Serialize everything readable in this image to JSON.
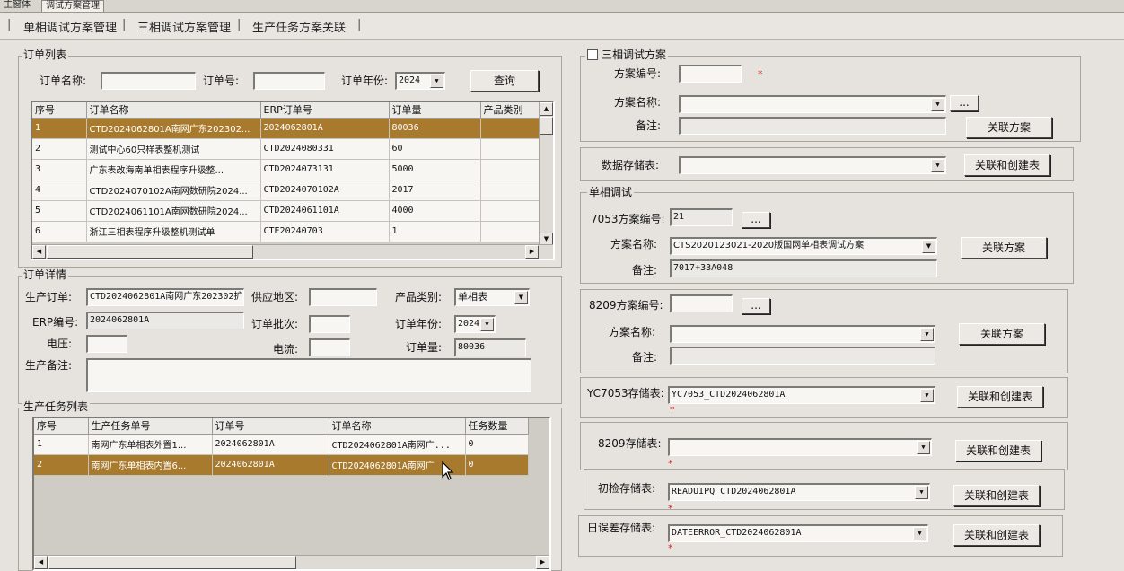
{
  "tabs": [
    "主窗体",
    "调试方案管理"
  ],
  "menu": [
    "单相调试方案管理",
    "三相调试方案管理",
    "生产任务方案关联"
  ],
  "order_list": {
    "title": "订单列表",
    "name_label": "订单名称:",
    "name_value": "",
    "no_label": "订单号:",
    "no_value": "",
    "year_label": "订单年份:",
    "year_value": "2024",
    "query_button": "查询",
    "columns": [
      "序号",
      "订单名称",
      "ERP订单号",
      "订单量",
      "产品类别"
    ],
    "rows": [
      [
        "1",
        "CTD2024062801A南网广东202302...",
        "2024062801A",
        "80036",
        ""
      ],
      [
        "2",
        "测试中心60只样表整机测试",
        "CTD2024080331",
        "60",
        ""
      ],
      [
        "3",
        "广东表改海南单相表程序升级整...",
        "CTD2024073131",
        "5000",
        ""
      ],
      [
        "4",
        "CTD2024070102A南网数研院2024...",
        "CTD2024070102A",
        "2017",
        ""
      ],
      [
        "5",
        "CTD2024061101A南网数研院2024...",
        "CTD2024061101A",
        "4000",
        ""
      ],
      [
        "6",
        "浙江三相表程序升级整机测试单",
        "CTE20240703",
        "1",
        ""
      ]
    ],
    "selected_row": 0
  },
  "order_detail": {
    "title": "订单详情",
    "prod_order_label": "生产订单:",
    "prod_order_value": "CTD2024062801A南网广东202302扩",
    "region_label": "供应地区:",
    "region_value": "",
    "category_label": "产品类别:",
    "category_value": "单相表",
    "erp_label": "ERP编号:",
    "erp_value": "2024062801A",
    "batch_label": "订单批次:",
    "batch_value": "",
    "year_label": "订单年份:",
    "year_value": "2024",
    "voltage_label": "电压:",
    "voltage_value": "",
    "current_label": "电流:",
    "current_value": "",
    "qty_label": "订单量:",
    "qty_value": "80036",
    "remark_label": "生产备注:",
    "remark_value": ""
  },
  "task_list": {
    "title": "生产任务列表",
    "columns": [
      "序号",
      "生产任务单号",
      "订单号",
      "订单名称",
      "任务数量"
    ],
    "rows": [
      [
        "1",
        "南网广东单相表外置1...",
        "2024062801A",
        "CTD2024062801A南网广...",
        "0"
      ],
      [
        "2",
        "南网广东单相表内置6...",
        "2024062801A",
        "CTD2024062801A南网广",
        "0"
      ]
    ],
    "selected_row": 1
  },
  "three_phase": {
    "title": "三相调试方案",
    "scheme_no_label": "方案编号:",
    "scheme_no_value": "",
    "scheme_name_label": "方案名称:",
    "scheme_name_value": "",
    "browse_label": "...",
    "remark_label": "备注:",
    "remark_value": "",
    "link_button": "关联方案"
  },
  "data_storage": {
    "label": "数据存储表:",
    "value": "",
    "button": "关联和创建表"
  },
  "single_phase": {
    "title": "单相调试",
    "s7053_no_label": "7053方案编号:",
    "s7053_no_value": "21",
    "s7053_browse": "...",
    "s7053_name_label": "方案名称:",
    "s7053_name_value": "CTS2020123021-2020版国网单相表调试方案",
    "s7053_link_button": "关联方案",
    "s7053_remark_label": "备注:",
    "s7053_remark_value": "7017+33A048",
    "s8209_no_label": "8209方案编号:",
    "s8209_no_value": "",
    "s8209_browse": "...",
    "s8209_name_label": "方案名称:",
    "s8209_name_value": "",
    "s8209_link_button": "关联方案",
    "s8209_remark_label": "备注:",
    "s8209_remark_value": ""
  },
  "storage_tables": [
    {
      "label": "YC7053存储表:",
      "value": "YC7053_CTD2024062801A",
      "button": "关联和创建表"
    },
    {
      "label": "8209存储表:",
      "value": "",
      "button": "关联和创建表"
    },
    {
      "label": "初检存储表:",
      "value": "READUIPQ_CTD2024062801A",
      "button": "关联和创建表"
    },
    {
      "label": "日误差存储表:",
      "value": "DATEERROR_CTD2024062801A",
      "button": "关联和创建表"
    }
  ],
  "required_mark": "*",
  "colors": {
    "selection": "#a77a2e",
    "window_bg": "#e6e3de",
    "required": "#d42020"
  }
}
